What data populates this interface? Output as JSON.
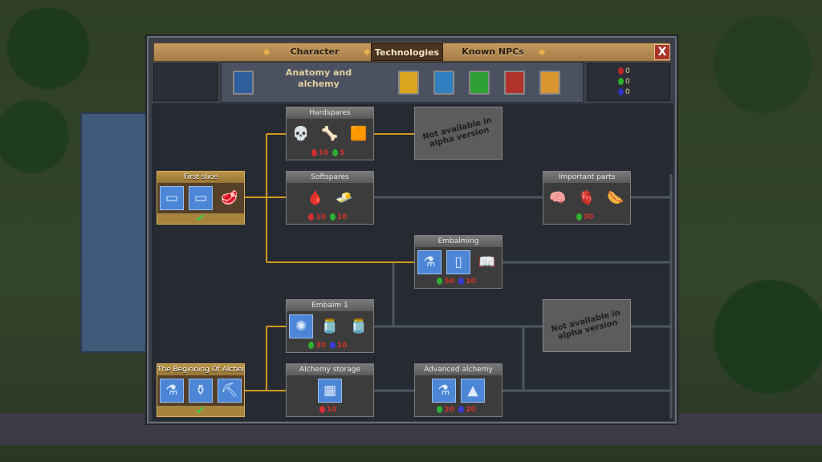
{
  "tabs": [
    {
      "label": "Character",
      "active": false
    },
    {
      "label": "Technologies",
      "active": true
    },
    {
      "label": "Known NPCs",
      "active": false
    }
  ],
  "close_label": "X",
  "current_category": "Anatomy and alchemy",
  "category_books": [
    {
      "name": "anatomy",
      "color": "#2f5e9c"
    },
    {
      "name": "astrology",
      "color": "#d9a520"
    },
    {
      "name": "writing",
      "color": "#2f7fc1"
    },
    {
      "name": "nature",
      "color": "#2ea035"
    },
    {
      "name": "crafting",
      "color": "#b0322a"
    },
    {
      "name": "numbers",
      "color": "#d99530"
    }
  ],
  "resources": [
    {
      "color": "#c02828",
      "value": "0"
    },
    {
      "color": "#2ab02a",
      "value": "0"
    },
    {
      "color": "#3030c0",
      "value": "0"
    }
  ],
  "colors": {
    "red_point": "#d03030",
    "green_point": "#30b030",
    "blue_point": "#3a3ad0",
    "learned_line": "#d39a1e"
  },
  "na_label": "Not available in alpha version",
  "cards": [
    {
      "id": "first-slice",
      "title": "First slice",
      "learned": true,
      "items": [
        {
          "icon": "blueprint-table",
          "bp": true,
          "g": "▭"
        },
        {
          "icon": "blueprint-table",
          "bp": true,
          "g": "▭"
        },
        {
          "icon": "meat-icon",
          "bp": false,
          "g": "🥩"
        }
      ],
      "cost": []
    },
    {
      "id": "hardspares",
      "title": "Hardspares",
      "learned": false,
      "items": [
        {
          "icon": "skull-icon",
          "g": "💀"
        },
        {
          "icon": "bone-icon",
          "g": "🦴"
        },
        {
          "icon": "skin-icon",
          "g": "🟧"
        }
      ],
      "cost": [
        {
          "gem": "red",
          "v": "10"
        },
        {
          "gem": "green",
          "v": "5"
        }
      ]
    },
    {
      "id": "softspares",
      "title": "Softspares",
      "learned": false,
      "items": [
        {
          "icon": "blood-icon",
          "g": "🩸"
        },
        {
          "icon": "fat-icon",
          "g": "🧈"
        }
      ],
      "cost": [
        {
          "gem": "red",
          "v": "10"
        },
        {
          "gem": "green",
          "v": "10"
        }
      ]
    },
    {
      "id": "important-parts",
      "title": "Important parts",
      "learned": false,
      "items": [
        {
          "icon": "brain-icon",
          "g": "🧠"
        },
        {
          "icon": "heart-icon",
          "g": "🫀"
        },
        {
          "icon": "intestines-icon",
          "g": "🌭"
        }
      ],
      "cost": [
        {
          "gem": "green",
          "v": "30"
        }
      ]
    },
    {
      "id": "embalming",
      "title": "Embalming",
      "learned": false,
      "items": [
        {
          "icon": "blueprint-embalming-table",
          "bp": true,
          "g": "⚗"
        },
        {
          "icon": "blueprint-cabinet",
          "bp": true,
          "g": "▯"
        },
        {
          "icon": "skull-book-icon",
          "g": "📖"
        }
      ],
      "cost": [
        {
          "gem": "green",
          "v": "50"
        },
        {
          "gem": "blue",
          "v": "10"
        }
      ]
    },
    {
      "id": "embalm-1",
      "title": "Embalm 1",
      "learned": false,
      "items": [
        {
          "icon": "blueprint-distiller",
          "bp": true,
          "g": "✺"
        },
        {
          "icon": "yellow-jar-icon",
          "g": "🫙"
        },
        {
          "icon": "blue-jar-icon",
          "g": "🫙"
        }
      ],
      "cost": [
        {
          "gem": "green",
          "v": "30"
        },
        {
          "gem": "blue",
          "v": "10"
        }
      ]
    },
    {
      "id": "beginning-alchemy",
      "title": "The Beginning Of Alchem",
      "learned": true,
      "items": [
        {
          "icon": "blueprint-flasks",
          "bp": true,
          "g": "⚗"
        },
        {
          "icon": "blueprint-jars",
          "bp": true,
          "g": "⚱"
        },
        {
          "icon": "blueprint-mortar",
          "bp": true,
          "g": "⛏"
        }
      ],
      "cost": []
    },
    {
      "id": "alchemy-storage",
      "title": "Alchemy storage",
      "learned": false,
      "items": [
        {
          "icon": "blueprint-storage",
          "bp": true,
          "g": "▦"
        }
      ],
      "cost": [
        {
          "gem": "red",
          "v": "10"
        }
      ]
    },
    {
      "id": "advanced-alchemy",
      "title": "Advanced alchemy",
      "learned": false,
      "items": [
        {
          "icon": "blueprint-flasks",
          "bp": true,
          "g": "⚗"
        },
        {
          "icon": "blueprint-furnace",
          "bp": true,
          "g": "▲"
        }
      ],
      "cost": [
        {
          "gem": "green",
          "v": "20"
        },
        {
          "gem": "blue",
          "v": "20"
        }
      ]
    }
  ]
}
